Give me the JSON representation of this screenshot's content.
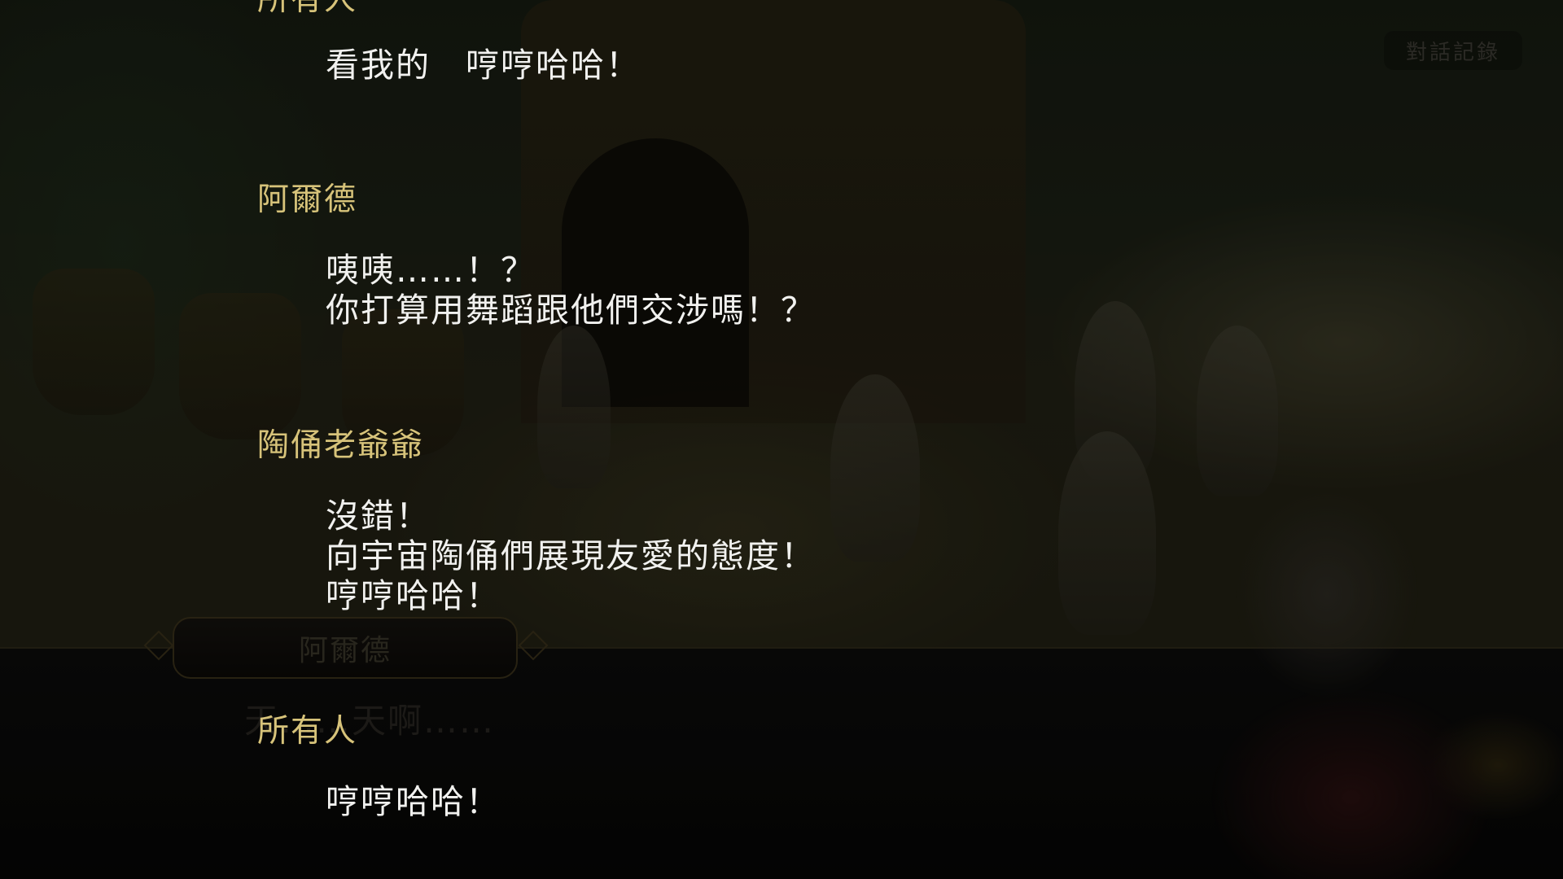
{
  "log_button": {
    "label": "對話記錄"
  },
  "background": {
    "nameplate_name": "阿爾德",
    "underlying_line": "天……天啊……"
  },
  "backlog": [
    {
      "speaker": "所有人",
      "lines": [
        "看我的　哼哼哈哈！"
      ]
    },
    {
      "speaker": "阿爾德",
      "lines": [
        "咦咦……！？",
        "你打算用舞蹈跟他們交涉嗎！？"
      ]
    },
    {
      "speaker": "陶俑老爺爺",
      "lines": [
        "沒錯！",
        "向宇宙陶俑們展現友愛的態度！",
        "哼哼哈哈！"
      ]
    },
    {
      "speaker": "所有人",
      "lines": [
        "哼哼哈哈！"
      ]
    }
  ],
  "colors": {
    "speaker_name": "#d7c37a",
    "dialogue_text": "#f1f1ef",
    "frame_gold": "#4a3f22"
  }
}
